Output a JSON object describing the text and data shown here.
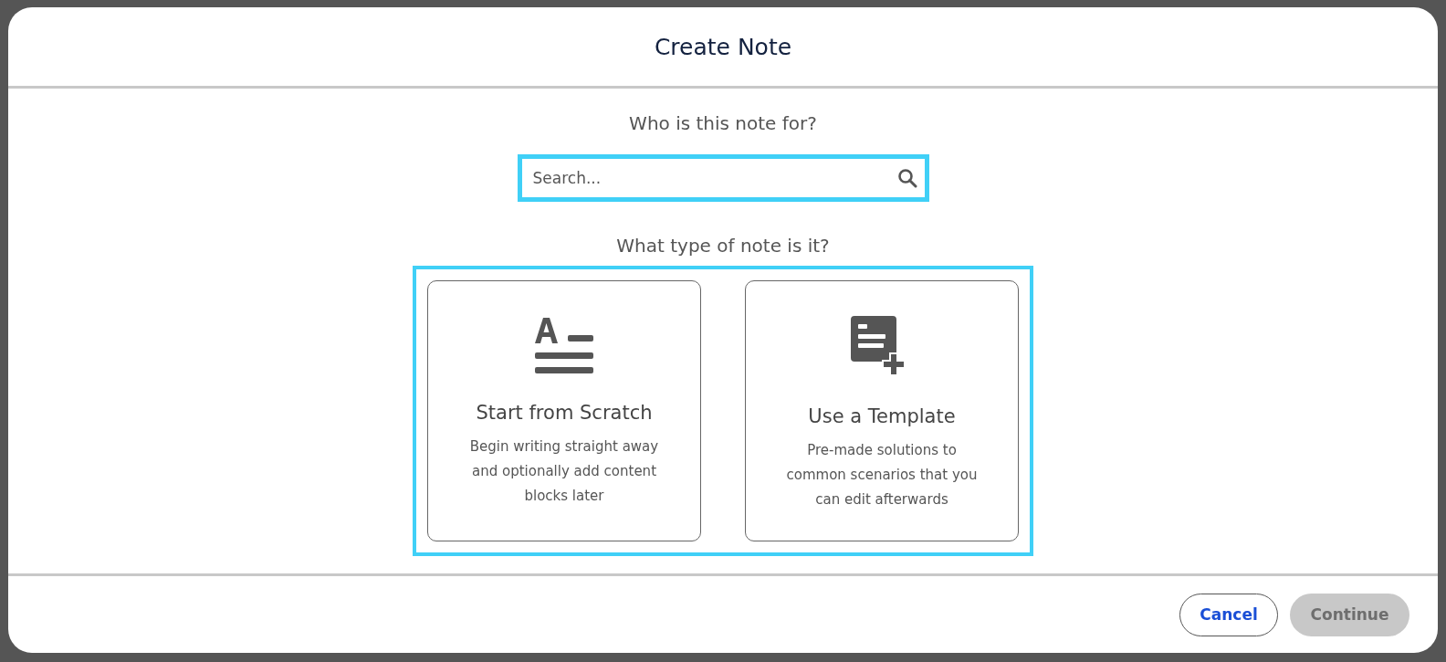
{
  "dialog": {
    "title": "Create Note"
  },
  "recipient": {
    "question": "Who is this note for?",
    "search": {
      "placeholder": "Search...",
      "highlighted": true
    }
  },
  "note_type": {
    "question": "What type of note is it?",
    "highlighted": true,
    "options": [
      {
        "kind": "scratch",
        "title": "Start from Scratch",
        "description": "Begin writing straight away and optionally add content blocks later",
        "selected": false
      },
      {
        "kind": "template",
        "title": "Use a Template",
        "description": "Pre-made solutions to common scenarios that you can edit afterwards",
        "selected": false
      }
    ]
  },
  "buttons": [
    {
      "kind": "secondary",
      "label": "Cancel",
      "disabled": false
    },
    {
      "kind": "primary",
      "label": "Continue",
      "disabled": true
    }
  ]
}
